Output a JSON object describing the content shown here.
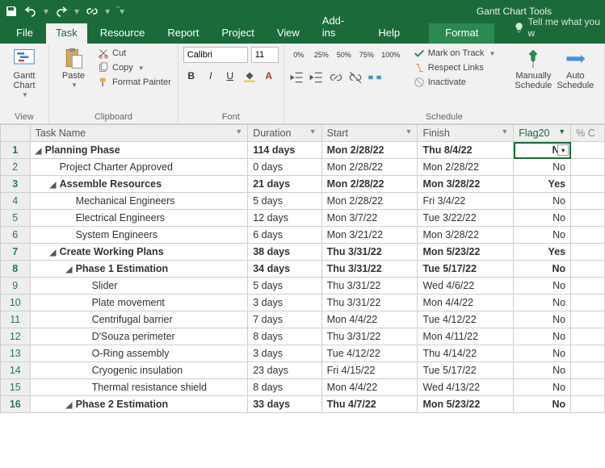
{
  "titlebar": {
    "tool_title": "Gantt Chart Tools"
  },
  "tabs": {
    "file": "File",
    "task": "Task",
    "resource": "Resource",
    "report": "Report",
    "project": "Project",
    "view": "View",
    "addins": "Add-ins",
    "help": "Help",
    "format": "Format",
    "tell": "Tell me what you w"
  },
  "ribbon": {
    "view": {
      "gantt": "Gantt Chart",
      "group": "View"
    },
    "clipboard": {
      "paste": "Paste",
      "cut": "Cut",
      "copy": "Copy",
      "formatpainter": "Format Painter",
      "group": "Clipboard"
    },
    "font": {
      "name": "Calibri",
      "size": "11",
      "group": "Font"
    },
    "schedule": {
      "markontrack": "Mark on Track",
      "respectlinks": "Respect Links",
      "inactivate": "Inactivate",
      "manual": "Manually Schedule",
      "auto": "Auto Schedule",
      "group": "Schedule"
    },
    "pct": [
      "0%",
      "25%",
      "50%",
      "75%",
      "100%"
    ]
  },
  "columns": {
    "task": "Task Name",
    "duration": "Duration",
    "start": "Start",
    "finish": "Finish",
    "flag": "Flag20",
    "pct": "% C"
  },
  "rows": [
    {
      "n": 1,
      "level": 0,
      "summary": true,
      "name": "Planning Phase",
      "dur": "114 days",
      "start": "Mon 2/28/22",
      "finish": "Thu 8/4/22",
      "flag": "No",
      "sel": true
    },
    {
      "n": 2,
      "level": 1,
      "summary": false,
      "name": "Project Charter Approved",
      "dur": "0 days",
      "start": "Mon 2/28/22",
      "finish": "Mon 2/28/22",
      "flag": "No"
    },
    {
      "n": 3,
      "level": 1,
      "summary": true,
      "name": "Assemble Resources",
      "dur": "21 days",
      "start": "Mon 2/28/22",
      "finish": "Mon 3/28/22",
      "flag": "Yes"
    },
    {
      "n": 4,
      "level": 2,
      "summary": false,
      "name": "Mechanical Engineers",
      "dur": "5 days",
      "start": "Mon 2/28/22",
      "finish": "Fri 3/4/22",
      "flag": "No"
    },
    {
      "n": 5,
      "level": 2,
      "summary": false,
      "name": "Electrical Engineers",
      "dur": "12 days",
      "start": "Mon 3/7/22",
      "finish": "Tue 3/22/22",
      "flag": "No"
    },
    {
      "n": 6,
      "level": 2,
      "summary": false,
      "name": "System Engineers",
      "dur": "6 days",
      "start": "Mon 3/21/22",
      "finish": "Mon 3/28/22",
      "flag": "No"
    },
    {
      "n": 7,
      "level": 1,
      "summary": true,
      "name": "Create Working Plans",
      "dur": "38 days",
      "start": "Thu 3/31/22",
      "finish": "Mon 5/23/22",
      "flag": "Yes"
    },
    {
      "n": 8,
      "level": 2,
      "summary": true,
      "name": "Phase 1 Estimation",
      "dur": "34 days",
      "start": "Thu 3/31/22",
      "finish": "Tue 5/17/22",
      "flag": "No"
    },
    {
      "n": 9,
      "level": 3,
      "summary": false,
      "name": "Slider",
      "dur": "5 days",
      "start": "Thu 3/31/22",
      "finish": "Wed 4/6/22",
      "flag": "No"
    },
    {
      "n": 10,
      "level": 3,
      "summary": false,
      "name": "Plate movement",
      "dur": "3 days",
      "start": "Thu 3/31/22",
      "finish": "Mon 4/4/22",
      "flag": "No"
    },
    {
      "n": 11,
      "level": 3,
      "summary": false,
      "name": "Centrifugal barrier",
      "dur": "7 days",
      "start": "Mon 4/4/22",
      "finish": "Tue 4/12/22",
      "flag": "No"
    },
    {
      "n": 12,
      "level": 3,
      "summary": false,
      "name": "D'Souza perimeter",
      "dur": "8 days",
      "start": "Thu 3/31/22",
      "finish": "Mon 4/11/22",
      "flag": "No"
    },
    {
      "n": 13,
      "level": 3,
      "summary": false,
      "name": "O-Ring assembly",
      "dur": "3 days",
      "start": "Tue 4/12/22",
      "finish": "Thu 4/14/22",
      "flag": "No"
    },
    {
      "n": 14,
      "level": 3,
      "summary": false,
      "name": "Cryogenic insulation",
      "dur": "23 days",
      "start": "Fri 4/15/22",
      "finish": "Tue 5/17/22",
      "flag": "No"
    },
    {
      "n": 15,
      "level": 3,
      "summary": false,
      "name": "Thermal resistance shield",
      "dur": "8 days",
      "start": "Mon 4/4/22",
      "finish": "Wed 4/13/22",
      "flag": "No"
    },
    {
      "n": 16,
      "level": 2,
      "summary": true,
      "name": "Phase 2 Estimation",
      "dur": "33 days",
      "start": "Thu 4/7/22",
      "finish": "Mon 5/23/22",
      "flag": "No"
    }
  ]
}
